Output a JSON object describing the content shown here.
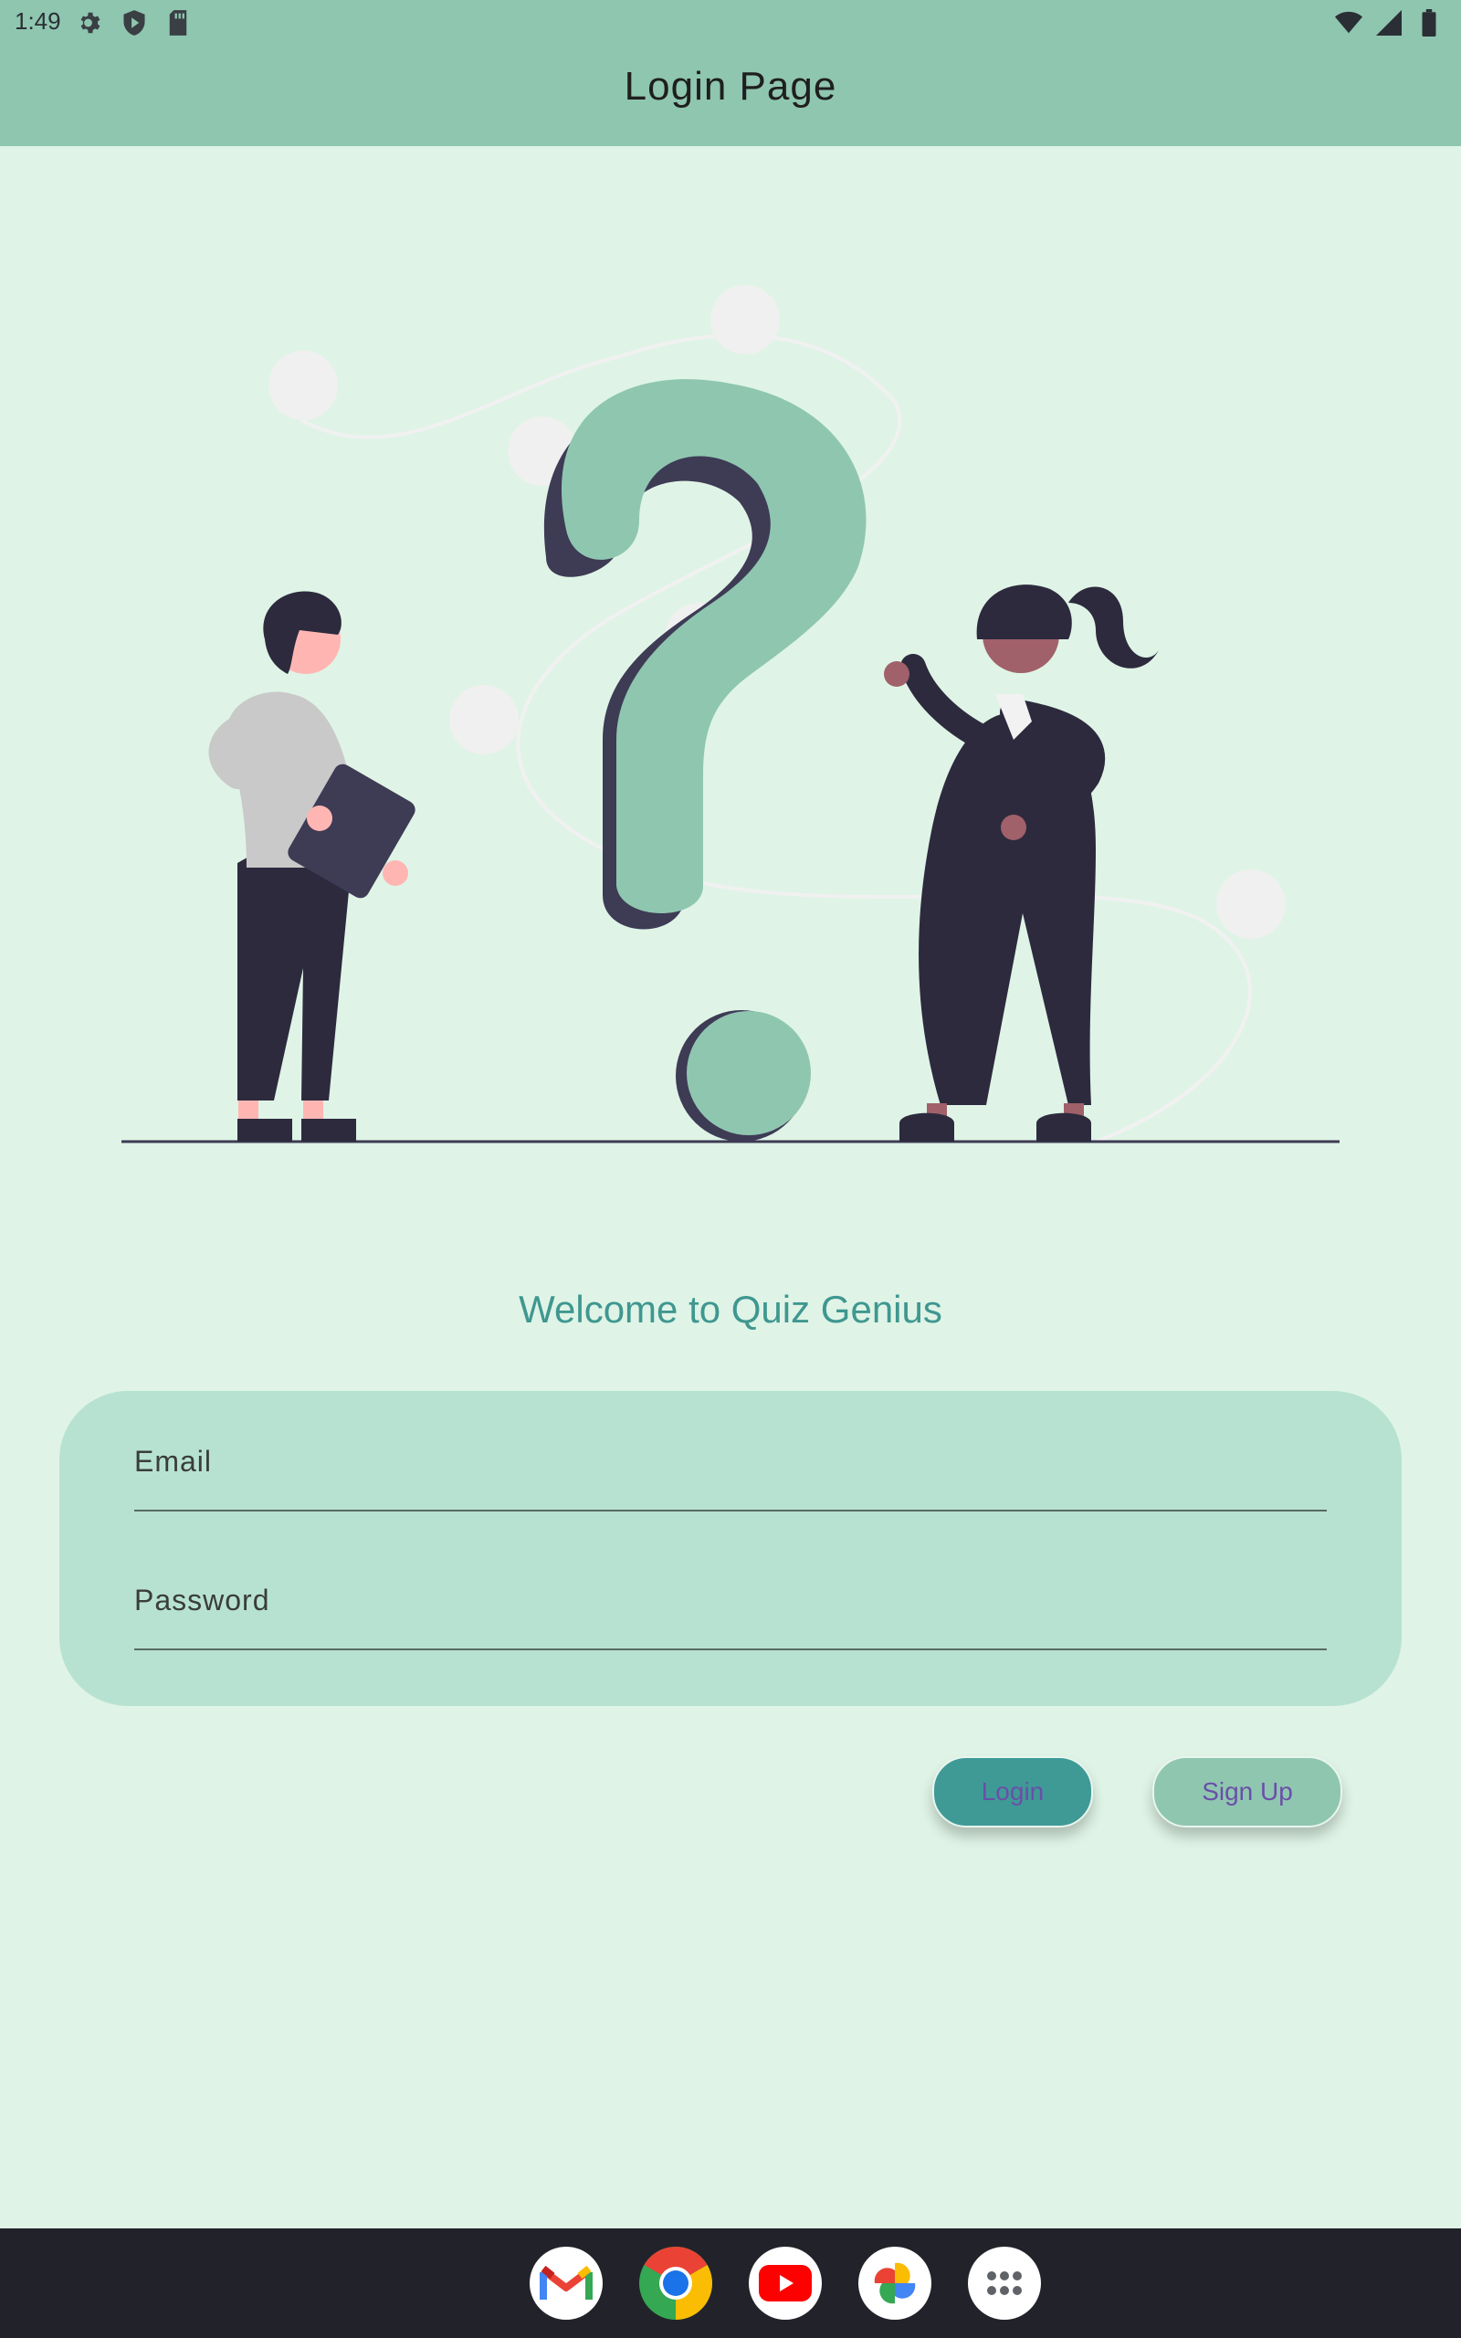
{
  "status_bar": {
    "time": "1:49",
    "left_icons": [
      "settings-icon",
      "shield-play-icon",
      "sd-card-icon"
    ],
    "right_icons": [
      "wifi-icon",
      "cell-signal-icon",
      "battery-icon"
    ]
  },
  "app_bar": {
    "title": "Login Page"
  },
  "colors": {
    "app_bar": "#8fc6b0",
    "background": "#dff4e6",
    "accent": "#3f9790",
    "form_card": "#b7e2d2",
    "login_button": "#3f9a96",
    "signup_button": "#8fc6b0",
    "button_text": "#6a4fa8"
  },
  "illustration": {
    "icon": "question-mark-people-illustration"
  },
  "welcome_text": "Welcome to Quiz Genius",
  "form": {
    "email": {
      "placeholder": "Email",
      "value": ""
    },
    "password": {
      "placeholder": "Password",
      "value": ""
    }
  },
  "buttons": {
    "login": "Login",
    "signup": "Sign Up"
  },
  "dock": {
    "apps": [
      "gmail-icon",
      "chrome-icon",
      "youtube-icon",
      "photos-icon",
      "app-drawer-icon"
    ]
  }
}
